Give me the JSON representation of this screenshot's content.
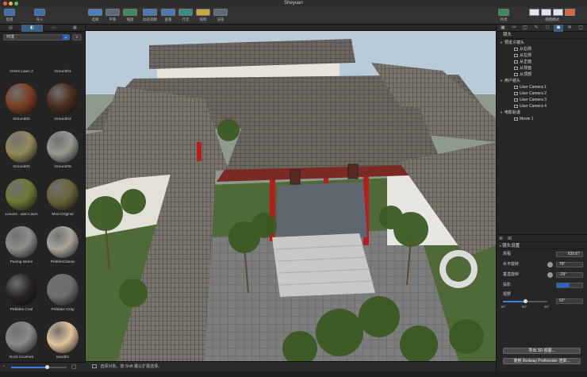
{
  "window": {
    "title": "Sheyuan"
  },
  "toolbar": {
    "left": [
      {
        "label": "指南"
      },
      {
        "label": "导入"
      }
    ],
    "center": [
      {
        "label": "选择"
      },
      {
        "label": "平移"
      },
      {
        "label": "缩放"
      },
      {
        "label": "动态观察"
      },
      {
        "label": "查看"
      },
      {
        "label": "行走"
      },
      {
        "label": "照明"
      },
      {
        "label": "渲染"
      }
    ],
    "right": [
      {
        "label": "共享"
      },
      {
        "label": "视图模式"
      }
    ]
  },
  "sidebar": {
    "filter_value": "环境",
    "materials": [
      {
        "name": "Grass Lawn 2",
        "color": "#5b7a2f"
      },
      {
        "name": "Ground01",
        "color": "#6b4a30"
      },
      {
        "name": "Ground02",
        "color": "#7a3f22"
      },
      {
        "name": "Ground03",
        "color": "#4a2e1e"
      },
      {
        "name": "Ground04",
        "color": "#948a5a"
      },
      {
        "name": "Ground05",
        "color": "#9a9890"
      },
      {
        "name": "Leaves...awn Lawn",
        "color": "#6e7a36"
      },
      {
        "name": "Mud Original",
        "color": "#6a6238"
      },
      {
        "name": "Paving Stone",
        "color": "#8c8c88"
      },
      {
        "name": "PebbleClassic",
        "color": "#a8a59c"
      },
      {
        "name": "Pebbles Coal",
        "color": "#2a2624"
      },
      {
        "name": "Pebbles Gray",
        "color": "#6e6e6e"
      },
      {
        "name": "Rock Crushed",
        "color": "#8a8a8a"
      },
      {
        "name": "Sand01",
        "color": "#e0c49a"
      }
    ]
  },
  "status": {
    "text": "选择对象。按 Shift 键以扩展选择。"
  },
  "right_panel": {
    "section_title": "镜头",
    "tree": [
      {
        "label": "预定义镜头",
        "indent": 0,
        "toggle": true,
        "camera": false
      },
      {
        "label": "从右侧",
        "indent": 2,
        "toggle": false,
        "camera": true
      },
      {
        "label": "从左侧",
        "indent": 2,
        "toggle": false,
        "camera": true
      },
      {
        "label": "从正面",
        "indent": 2,
        "toggle": false,
        "camera": true
      },
      {
        "label": "从背面",
        "indent": 2,
        "toggle": false,
        "camera": true
      },
      {
        "label": "从顶部",
        "indent": 2,
        "toggle": false,
        "camera": true
      },
      {
        "label": "用户镜头",
        "indent": 0,
        "toggle": true,
        "camera": false
      },
      {
        "label": "User Camera 1",
        "indent": 2,
        "toggle": false,
        "camera": true
      },
      {
        "label": "User Camera 2",
        "indent": 2,
        "toggle": false,
        "camera": true
      },
      {
        "label": "User Camera 3",
        "indent": 2,
        "toggle": false,
        "camera": true
      },
      {
        "label": "User Camera 4",
        "indent": 2,
        "toggle": false,
        "camera": true
      },
      {
        "label": "电影轨道",
        "indent": 0,
        "toggle": true,
        "camera": false
      },
      {
        "label": "Movie 1",
        "indent": 2,
        "toggle": false,
        "camera": true
      }
    ],
    "settings_title": "镜头设置",
    "height_label": "高程",
    "height_value": "639.67",
    "horiz_label": "水平旋转",
    "horiz_value": "79°",
    "vert_label": "垂直旋转",
    "vert_value": "-29°",
    "proj_label": "投影",
    "fov_label": "视野",
    "fov_value": "60°",
    "fov_ticks": [
      "30°",
      "60°",
      "90°"
    ],
    "export_button": "导出 3D 视图...",
    "render_button": "使用 Redway Profirender 渲染..."
  }
}
